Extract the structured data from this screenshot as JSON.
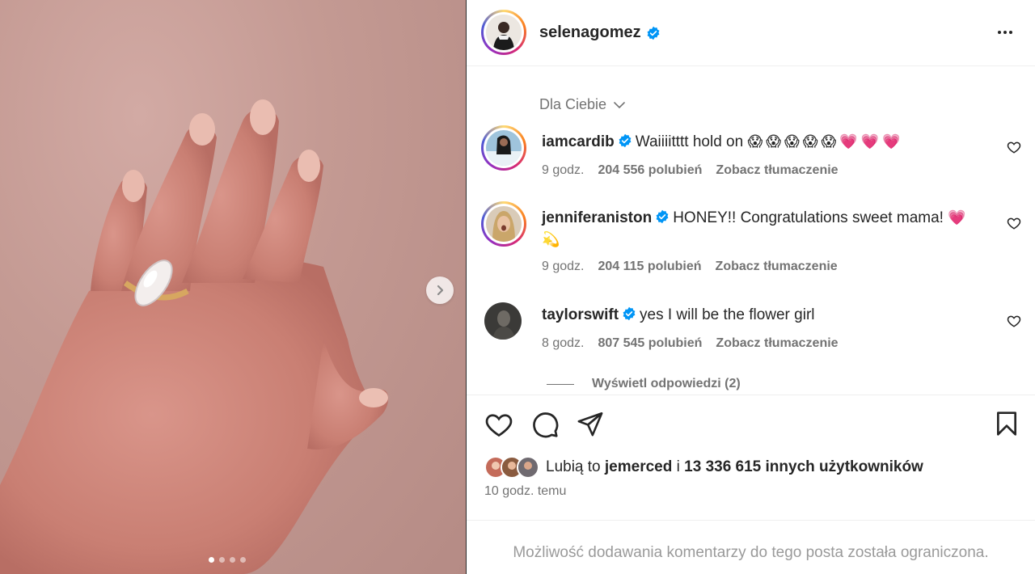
{
  "post": {
    "author": "selenagomez",
    "verified": true,
    "carousel": {
      "total": 4,
      "active_index": 0
    }
  },
  "comments_section": {
    "sort_label": "Dla Ciebie",
    "comments": [
      {
        "username": "iamcardib",
        "verified": true,
        "text": "Waiiiitttt hold on",
        "emojis": "😱😱😱😱😱💗💗💗",
        "time": "9 godz.",
        "likes": "204 556 polubień",
        "translate": "Zobacz tłumaczenie"
      },
      {
        "username": "jenniferaniston",
        "verified": true,
        "text": "HONEY!! Congratulations sweet mama!",
        "emojis": "💗",
        "emojis_line2": "💫",
        "time": "9 godz.",
        "likes": "204 115 polubień",
        "translate": "Zobacz tłumaczenie"
      },
      {
        "username": "taylorswift",
        "verified": true,
        "text": "yes I will be the flower girl",
        "time": "8 godz.",
        "likes": "807 545 polubień",
        "translate": "Zobacz tłumaczenie"
      }
    ],
    "view_replies": "Wyświetl odpowiedzi (2)"
  },
  "likes": {
    "prefix": "Lubią to",
    "user": "jemerced",
    "connector": "i",
    "others": "13 336 615 innych użytkowników"
  },
  "timestamp": "10 godz. temu",
  "comments_limited": "Możliwość dodawania komentarzy do tego posta została ograniczona.",
  "colors": {
    "verified": "#0095f6",
    "text": "#262626",
    "secondary": "#737373"
  }
}
